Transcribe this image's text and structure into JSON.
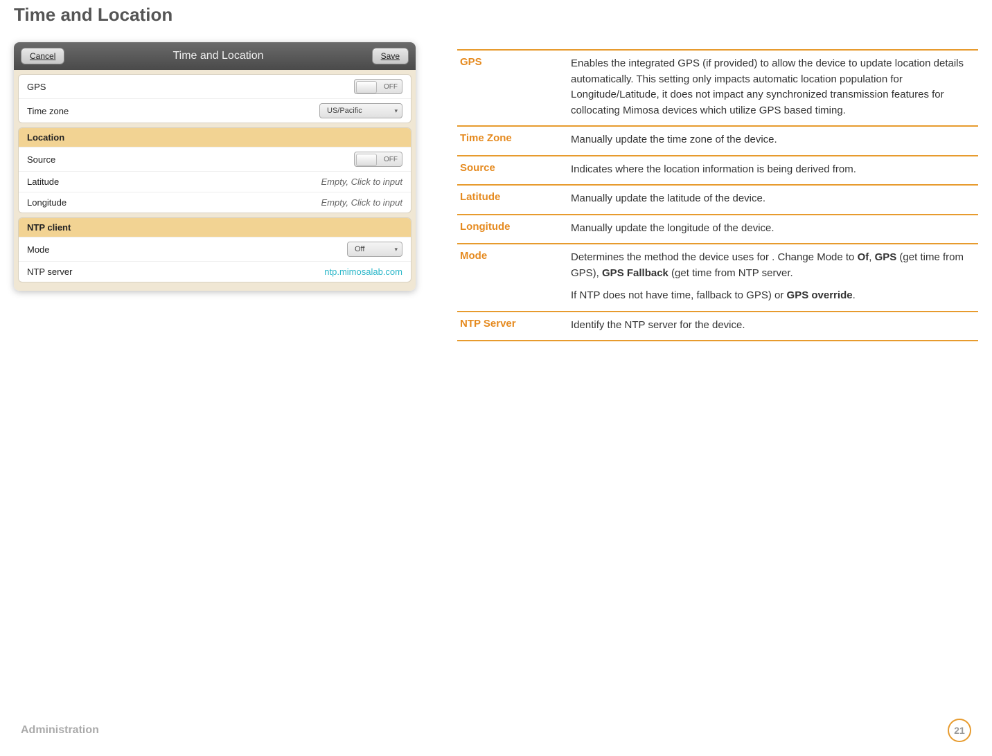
{
  "page": {
    "title": "Time and Location",
    "footer_section": "Administration",
    "page_number": "21"
  },
  "panel": {
    "cancel_label": "Cancel",
    "save_label": "Save",
    "title": "Time and Location",
    "rows": {
      "gps_label": "GPS",
      "gps_value": "OFF",
      "timezone_label": "Time zone",
      "timezone_value": "US/Pacific",
      "location_header": "Location",
      "source_label": "Source",
      "source_value": "OFF",
      "latitude_label": "Latitude",
      "latitude_value": "Empty, Click to input",
      "longitude_label": "Longitude",
      "longitude_value": "Empty, Click to input",
      "ntp_header": "NTP client",
      "mode_label": "Mode",
      "mode_value": "Off",
      "ntp_server_label": "NTP server",
      "ntp_server_value": "ntp.mimosalab.com"
    }
  },
  "definitions": {
    "gps": {
      "term": "GPS",
      "desc": "Enables the integrated GPS (if provided) to allow the device to update location details automatically. This setting only impacts automatic location population for Longitude/Latitude, it does not impact any synchronized transmission features for collocating Mimosa devices which utilize GPS based timing."
    },
    "timezone": {
      "term": "Time Zone",
      "desc": "Manually update the time zone of the device."
    },
    "source": {
      "term": "Source",
      "desc": "Indicates where the location information is being derived from."
    },
    "latitude": {
      "term": "Latitude",
      "desc": "Manually update the latitude of the device."
    },
    "longitude": {
      "term": "Longitude",
      "desc": "Manually update the longitude of the device."
    },
    "mode": {
      "term": "Mode",
      "p1_a": "Determines the method the device uses for . Change Mode to ",
      "p1_b1": "Of",
      "p1_c": ", ",
      "p1_b2": "GPS",
      "p1_d": " (get time from GPS), ",
      "p1_b3": "GPS Fallback",
      "p1_e": " (get time from NTP server.",
      "p2_a": "If NTP does not have time, fallback to GPS) or ",
      "p2_b": "GPS override",
      "p2_c": "."
    },
    "ntpserver": {
      "term": "NTP Server",
      "desc": "Identify the NTP server for the device."
    }
  }
}
